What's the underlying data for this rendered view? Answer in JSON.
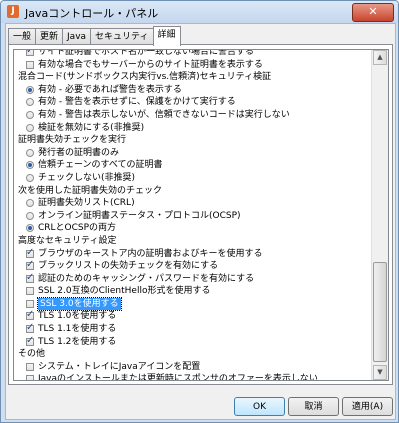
{
  "window": {
    "title": "Javaコントロール・パネル",
    "close_label": "✕"
  },
  "tabs": [
    "一般",
    "更新",
    "Java",
    "セキュリティ",
    "詳細"
  ],
  "settings": [
    {
      "kind": "check",
      "on": true,
      "label": "サイト証明書でホスト名が一致しない場合に警告する"
    },
    {
      "kind": "check",
      "on": false,
      "label": "有効な場合でもサーバーからのサイト証明書を表示する"
    },
    {
      "kind": "heading",
      "label": "混合コード(サンドボックス内実行vs.信頼済)セキュリティ検証"
    },
    {
      "kind": "radio",
      "on": true,
      "label": "有効 - 必要であれば警告を表示する"
    },
    {
      "kind": "radio",
      "on": false,
      "label": "有効 - 警告を表示せずに、保護をかけて実行する"
    },
    {
      "kind": "radio",
      "on": false,
      "label": "有効 - 警告は表示しないが、信頼できないコードは実行しない"
    },
    {
      "kind": "radio",
      "on": false,
      "label": "検証を無効にする(非推奨)"
    },
    {
      "kind": "heading",
      "label": "証明書失効チェックを実行"
    },
    {
      "kind": "radio",
      "on": false,
      "label": "発行者の証明書のみ"
    },
    {
      "kind": "radio",
      "on": true,
      "label": "信頼チェーンのすべての証明書"
    },
    {
      "kind": "radio",
      "on": false,
      "label": "チェックしない(非推奨)"
    },
    {
      "kind": "heading",
      "label": "次を使用した証明書失効のチェック"
    },
    {
      "kind": "radio",
      "on": false,
      "label": "証明書失効リスト(CRL)"
    },
    {
      "kind": "radio",
      "on": false,
      "label": "オンライン証明書ステータス・プロトコル(OCSP)"
    },
    {
      "kind": "radio",
      "on": true,
      "label": "CRLとOCSPの両方"
    },
    {
      "kind": "heading",
      "label": "高度なセキュリティ設定"
    },
    {
      "kind": "check",
      "on": true,
      "label": "ブラウザのキーストア内の証明書およびキーを使用する"
    },
    {
      "kind": "check",
      "on": true,
      "label": "ブラックリストの失効チェックを有効にする"
    },
    {
      "kind": "check",
      "on": true,
      "label": "認証のためのキャッシング・パスワードを有効にする"
    },
    {
      "kind": "check",
      "on": false,
      "label": "SSL 2.0互換のClientHello形式を使用する"
    },
    {
      "kind": "check",
      "on": false,
      "label": "SSL 3.0を使用する",
      "selected": true
    },
    {
      "kind": "check",
      "on": true,
      "label": "TLS 1.0を使用する"
    },
    {
      "kind": "check",
      "on": true,
      "label": "TLS 1.1を使用する"
    },
    {
      "kind": "check",
      "on": true,
      "label": "TLS 1.2を使用する"
    },
    {
      "kind": "heading",
      "label": "その他"
    },
    {
      "kind": "check",
      "on": false,
      "label": "システム・トレイにJavaアイコンを配置"
    },
    {
      "kind": "check",
      "on": false,
      "label": "Javaのインストールまたは更新時にスポンサのオファーを表示しない"
    }
  ],
  "buttons": {
    "ok": "OK",
    "cancel": "取消",
    "apply": "適用(A)"
  }
}
